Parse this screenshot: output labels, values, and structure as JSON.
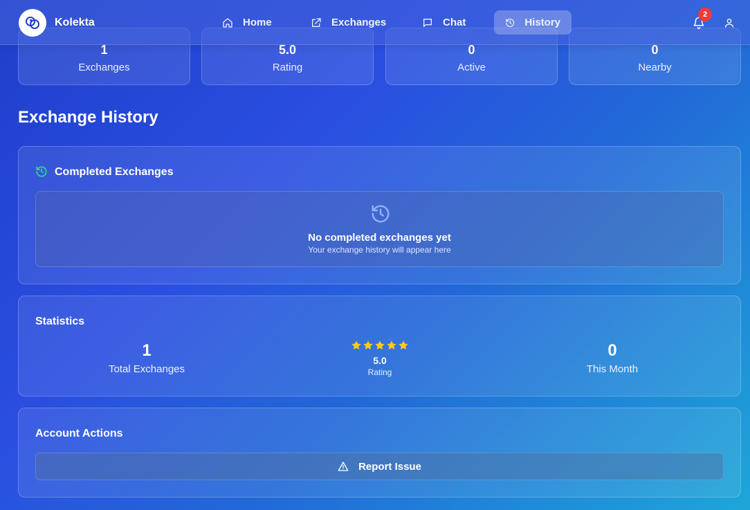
{
  "brand": {
    "name": "Kolekta"
  },
  "nav": [
    {
      "label": "Home",
      "icon": "home-icon",
      "active": false
    },
    {
      "label": "Exchanges",
      "icon": "external-link-icon",
      "active": false
    },
    {
      "label": "Chat",
      "icon": "chat-icon",
      "active": false
    },
    {
      "label": "History",
      "icon": "history-icon",
      "active": true
    }
  ],
  "notifications": {
    "count": "2"
  },
  "summary": [
    {
      "value": "1",
      "label": "Exchanges"
    },
    {
      "value": "5.0",
      "label": "Rating"
    },
    {
      "value": "0",
      "label": "Active"
    },
    {
      "value": "0",
      "label": "Nearby"
    }
  ],
  "page": {
    "title": "Exchange History"
  },
  "completed": {
    "title": "Completed Exchanges",
    "empty_title": "No completed exchanges yet",
    "empty_subtitle": "Your exchange history will appear here"
  },
  "statistics": {
    "title": "Statistics",
    "total_value": "1",
    "total_label": "Total Exchanges",
    "stars": 5,
    "rating_value": "5.0",
    "rating_label": "Rating",
    "month_value": "0",
    "month_label": "This Month"
  },
  "account": {
    "title": "Account Actions",
    "report_label": "Report Issue"
  },
  "colors": {
    "accent_green": "#34d399",
    "star": "#facc15",
    "badge": "#ef3b3b"
  }
}
